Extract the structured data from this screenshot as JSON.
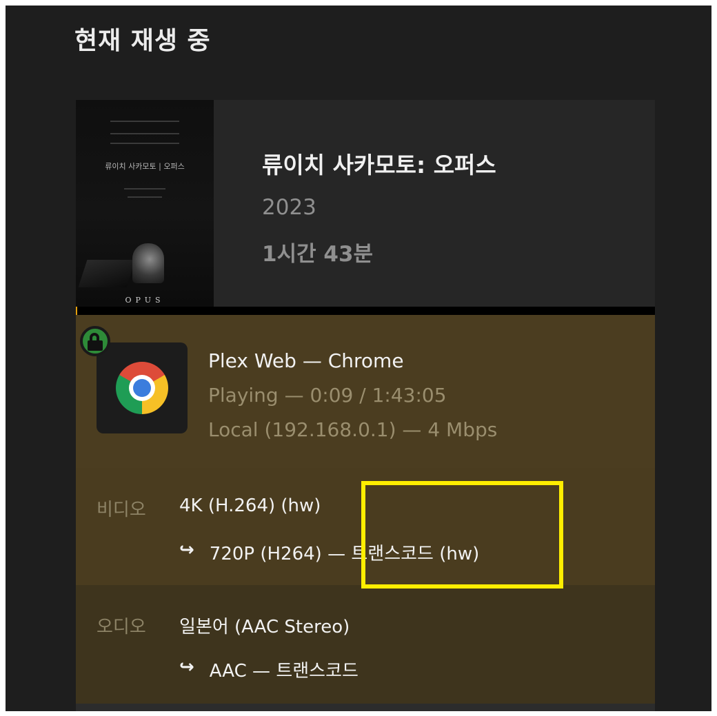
{
  "header": {
    "title": "현재 재생 중"
  },
  "media": {
    "poster": {
      "title_text": "류이치 사카모토 | 오퍼스",
      "bottom_text": "OPUS"
    },
    "title": "류이치 사카모토: 오퍼스",
    "year": "2023",
    "duration": "1시간 43분",
    "progress": 0.0015
  },
  "session": {
    "player_icon": "chrome-icon",
    "status_icon": "lock-icon",
    "player": "Plex Web — Chrome",
    "state": "Playing — 0:09 / 1:43:05",
    "network": "Local (192.168.0.1) — 4 Mbps"
  },
  "streams": {
    "video": {
      "label": "비디오",
      "source": "4K (H.264) (hw)",
      "arrow": "↪",
      "target": "720P (H264) — 트랜스코드 (hw)"
    },
    "audio": {
      "label": "오디오",
      "source": "일본어 (AAC Stereo)",
      "arrow": "↪",
      "target": "AAC — 트랜스코드"
    }
  },
  "colors": {
    "background": "#1e1e1e",
    "session_bg": "#4b3d20",
    "progress": "#e5a00d",
    "highlight": "#ffee00",
    "lock_badge": "#2e8b38"
  }
}
